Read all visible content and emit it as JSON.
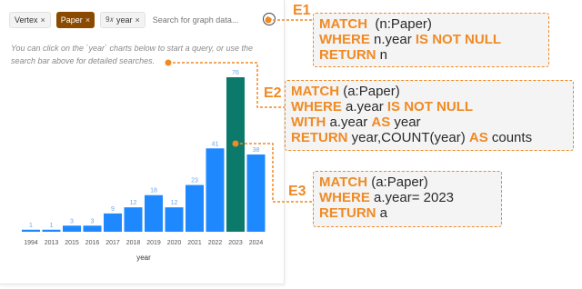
{
  "search": {
    "tags": [
      "Vertex",
      "Paper"
    ],
    "property_prefix": "9𝑥",
    "property_label": "year",
    "placeholder": "Search for graph data..."
  },
  "hint": "You can click on the `year` charts below to start a query, or use the search bar above for detailed searches.",
  "chart_data": {
    "type": "bar",
    "xlabel": "year",
    "categories": [
      "1994",
      "2013",
      "2015",
      "2016",
      "2017",
      "2018",
      "2019",
      "2020",
      "2021",
      "2022",
      "2023",
      "2024"
    ],
    "values": [
      1,
      1,
      3,
      3,
      9,
      12,
      18,
      12,
      23,
      41,
      76,
      38
    ],
    "highlight_index": 10,
    "colors": {
      "bar": "#1e88ff",
      "highlight": "#0b7a6a",
      "label": "#6fa6e8"
    }
  },
  "annotations": {
    "e1": {
      "label": "E1",
      "lines": [
        [
          {
            "t": "MATCH",
            "k": true
          },
          {
            "t": "  (n:Paper)",
            "k": false
          }
        ],
        [
          {
            "t": "WHERE",
            "k": true
          },
          {
            "t": " n.year ",
            "k": false
          },
          {
            "t": "IS NOT NULL",
            "k": true
          }
        ],
        [
          {
            "t": "RETURN",
            "k": true
          },
          {
            "t": " n",
            "k": false
          }
        ]
      ]
    },
    "e2": {
      "label": "E2",
      "lines": [
        [
          {
            "t": "MATCH",
            "k": true
          },
          {
            "t": " (a:Paper)",
            "k": false
          }
        ],
        [
          {
            "t": "WHERE",
            "k": true
          },
          {
            "t": " a.year ",
            "k": false
          },
          {
            "t": "IS NOT NULL",
            "k": true
          }
        ],
        [
          {
            "t": "WITH",
            "k": true
          },
          {
            "t": " a.year ",
            "k": false
          },
          {
            "t": "AS",
            "k": true
          },
          {
            "t": " year",
            "k": false
          }
        ],
        [
          {
            "t": "RETURN",
            "k": true
          },
          {
            "t": " year,COUNT(year) ",
            "k": false
          },
          {
            "t": "AS",
            "k": true
          },
          {
            "t": " counts",
            "k": false
          }
        ]
      ]
    },
    "e3": {
      "label": "E3",
      "lines": [
        [
          {
            "t": "MATCH",
            "k": true
          },
          {
            "t": " (a:Paper)",
            "k": false
          }
        ],
        [
          {
            "t": "WHERE",
            "k": true
          },
          {
            "t": " a.year= 2023",
            "k": false
          }
        ],
        [
          {
            "t": "RETURN",
            "k": true
          },
          {
            "t": " a",
            "k": false
          }
        ]
      ]
    },
    "colors": {
      "accent": "#f08a24",
      "box": "#f4f4f4"
    }
  }
}
